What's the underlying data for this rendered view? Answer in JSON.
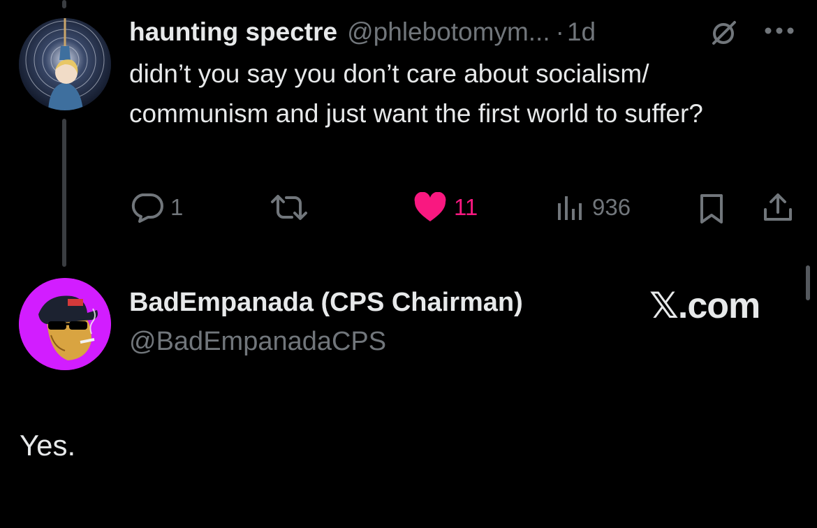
{
  "parent_tweet": {
    "display_name": "haunting spectre",
    "handle": "@phlebotomym...",
    "separator": "·",
    "time": "1d",
    "text": "didn’t you say you don’t care about socialism/ communism and just want the first world to suffer?",
    "actions": {
      "replies": "1",
      "retweets": "",
      "likes": "11",
      "views": "936"
    },
    "icons": [
      "grok-icon",
      "more-icon",
      "reply-icon",
      "retweet-icon",
      "heart-icon",
      "views-icon",
      "bookmark-icon",
      "share-icon"
    ]
  },
  "reply_tweet": {
    "display_name": "BadEmpanada (CPS Chairman)",
    "handle": "@BadEmpanadaCPS",
    "text": "Yes."
  },
  "watermark": "𝕏.com",
  "colors": {
    "background": "#000000",
    "text": "#e7e9ea",
    "muted": "#71767b",
    "like": "#f91880",
    "avatar_reply_bg": "#d21dff"
  }
}
